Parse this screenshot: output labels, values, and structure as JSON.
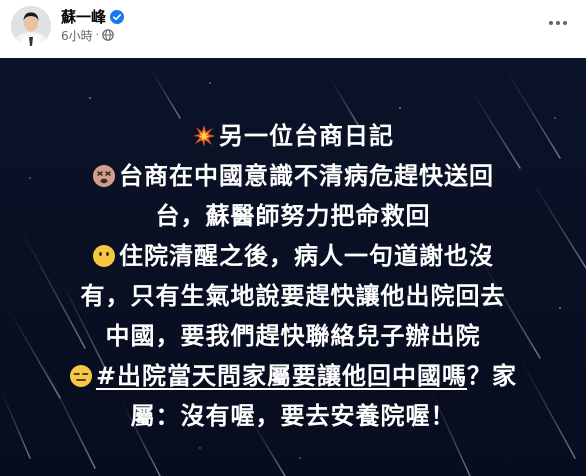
{
  "post": {
    "author": "蘇一峰",
    "time": "6小時",
    "separator": "·",
    "icons": {
      "verified": "verified-badge-icon",
      "audience": "globe-icon",
      "more": "more-options-icon"
    },
    "colors": {
      "verified": "#1877f2",
      "card_background": "#0a1226",
      "text": "#ffffff"
    },
    "content": {
      "line1": "另一位台商日記",
      "line2": "台商在中國意識不清病危趕快送回",
      "line3": "台，蘇醫師努力把命救回",
      "line4": "住院清醒之後，病人一句道謝也沒",
      "line5": "有，只有生氣地說要趕快讓他出院回去",
      "line6": "中國，要我們趕快聯絡兒子辦出院",
      "hashtag": "#出院當天問家屬要讓他回中國嗎",
      "line7_tail": "？家",
      "line8": "屬：沒有喔，要去安養院喔！"
    }
  }
}
